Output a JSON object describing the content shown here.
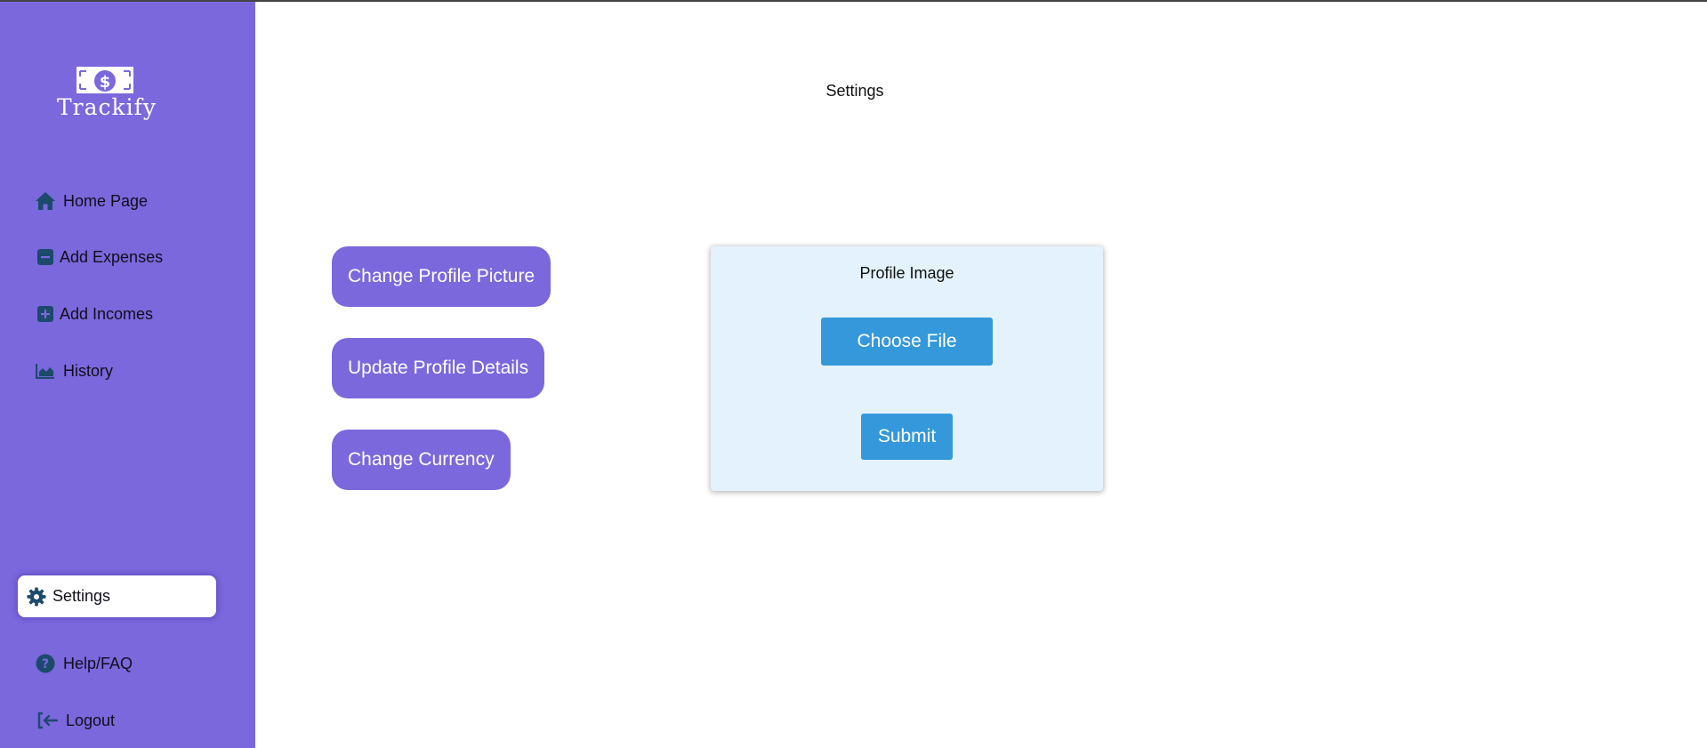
{
  "app": {
    "brand": "Trackify",
    "logo_icon": "dollar-bill-icon"
  },
  "colors": {
    "sidebar": "#7b68dd",
    "icon": "#1b4a6b",
    "primary_button": "#3498db",
    "card_background": "#e3f2fd"
  },
  "sidebar": {
    "items": [
      {
        "label": "Home Page",
        "icon": "home-icon"
      },
      {
        "label": "Add Expenses",
        "icon": "minus-square-icon"
      },
      {
        "label": "Add Incomes",
        "icon": "plus-square-icon"
      },
      {
        "label": "History",
        "icon": "area-chart-icon"
      }
    ],
    "active_item": {
      "label": "Settings",
      "icon": "gear-icon"
    },
    "bottom_items": [
      {
        "label": "Help/FAQ",
        "icon": "question-circle-icon"
      },
      {
        "label": "Logout",
        "icon": "logout-icon"
      }
    ]
  },
  "main": {
    "title": "Settings",
    "options": [
      {
        "label": "Change Profile Picture"
      },
      {
        "label": "Update Profile Details"
      },
      {
        "label": "Change Currency"
      }
    ],
    "profile_card": {
      "title": "Profile Image",
      "choose_label": "Choose File",
      "submit_label": "Submit"
    }
  }
}
